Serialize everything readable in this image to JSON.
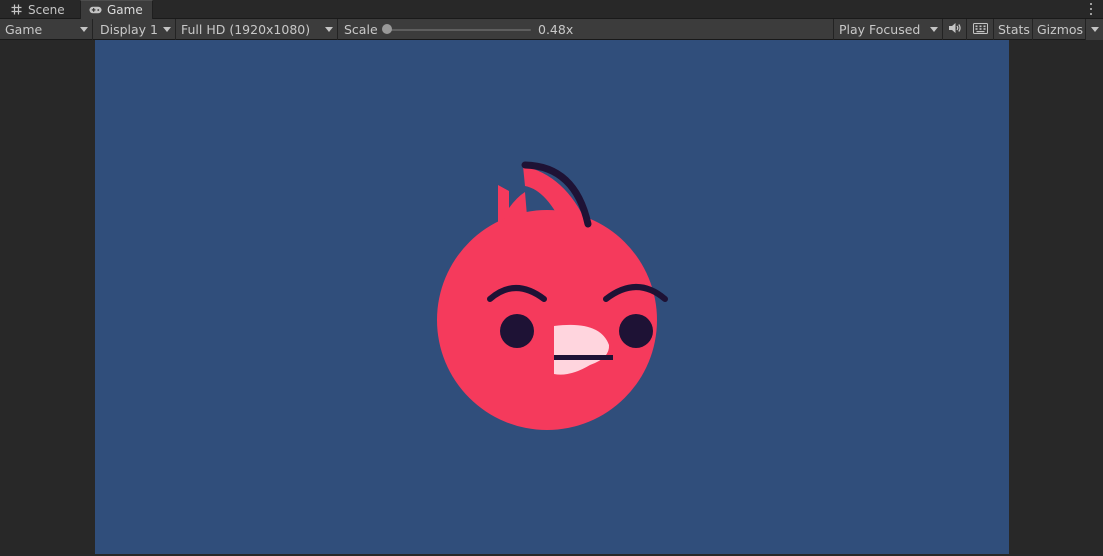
{
  "tabs": [
    {
      "label": "Scene",
      "icon": "scene-grid-icon",
      "active": false
    },
    {
      "label": "Game",
      "icon": "gamepad-icon",
      "active": true
    }
  ],
  "toolbar": {
    "view_dropdown": "Game",
    "display_dropdown": "Display 1",
    "resolution_dropdown": "Full HD (1920x1080)",
    "scale_label": "Scale",
    "scale_value": "0.48x",
    "scale": 0.48,
    "play_mode_dropdown": "Play Focused",
    "audio_icon": "speaker-icon",
    "keyboard_icon": "keyboard-icon",
    "stats_label": "Stats",
    "gizmos_label": "Gizmos"
  },
  "game_view": {
    "background_color": "#304e7b",
    "character": {
      "body_color": "#f53a5c",
      "feature_color": "#1e1235",
      "beak_color": "#ffd5de"
    }
  }
}
